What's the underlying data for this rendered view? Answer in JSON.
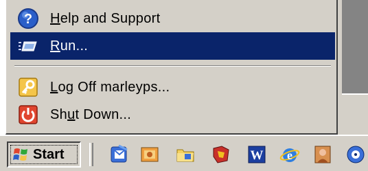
{
  "start_menu": {
    "items": [
      {
        "label_pre": "",
        "label_key": "H",
        "label_post": "elp and Support",
        "icon": "help-icon"
      },
      {
        "label_pre": "",
        "label_key": "R",
        "label_post": "un...",
        "icon": "run-icon",
        "selected": true
      },
      {
        "label_pre": "",
        "label_key": "L",
        "label_post": "og Off marleyps...",
        "icon": "key-icon"
      },
      {
        "label_pre": "Sh",
        "label_key": "u",
        "label_post": "t Down...",
        "icon": "shutdown-icon"
      }
    ]
  },
  "taskbar": {
    "start_label": "Start",
    "quick_launch": [
      "outlook-express-icon",
      "show-desktop-icon",
      "folder-icon",
      "app-icon",
      "word-icon",
      "internet-explorer-icon",
      "media-icon",
      "media-player-icon"
    ]
  },
  "colors": {
    "selection": "#0a246a",
    "face": "#d4d0c8"
  }
}
